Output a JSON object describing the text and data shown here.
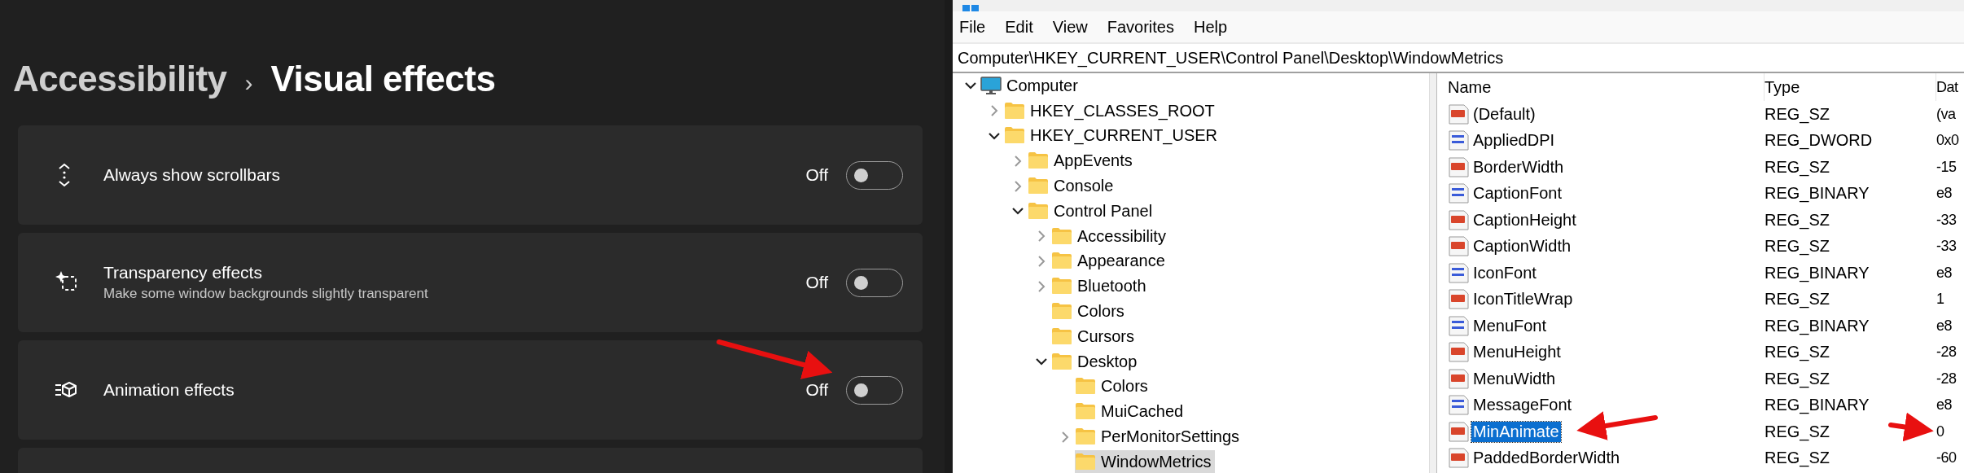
{
  "settings": {
    "breadcrumb": {
      "parent": "Accessibility",
      "separator": "›",
      "current": "Visual effects"
    },
    "cards": [
      {
        "kind": "scrollbars",
        "title": "Always show scrollbars",
        "state_label": "Off",
        "on": false
      },
      {
        "kind": "transparency",
        "title": "Transparency effects",
        "subtitle": "Make some window backgrounds slightly transparent",
        "state_label": "Off",
        "on": false
      },
      {
        "kind": "animation",
        "title": "Animation effects",
        "state_label": "Off",
        "on": false
      }
    ]
  },
  "registry": {
    "menu": [
      "File",
      "Edit",
      "View",
      "Favorites",
      "Help"
    ],
    "address": "Computer\\HKEY_CURRENT_USER\\Control Panel\\Desktop\\WindowMetrics",
    "tree": [
      {
        "label": "Computer",
        "kind": "computer",
        "expanded": true,
        "selected": false,
        "children": [
          {
            "label": "HKEY_CLASSES_ROOT",
            "kind": "branch",
            "expanded": false,
            "selected": false
          },
          {
            "label": "HKEY_CURRENT_USER",
            "kind": "branch",
            "expanded": true,
            "selected": false,
            "children": [
              {
                "label": "AppEvents",
                "kind": "branch",
                "expanded": false,
                "selected": false
              },
              {
                "label": "Console",
                "kind": "branch",
                "expanded": false,
                "selected": false
              },
              {
                "label": "Control Panel",
                "kind": "branch",
                "expanded": true,
                "selected": false,
                "children": [
                  {
                    "label": "Accessibility",
                    "kind": "branch",
                    "expanded": false,
                    "selected": false
                  },
                  {
                    "label": "Appearance",
                    "kind": "branch",
                    "expanded": false,
                    "selected": false
                  },
                  {
                    "label": "Bluetooth",
                    "kind": "branch",
                    "expanded": false,
                    "selected": false
                  },
                  {
                    "label": "Colors",
                    "kind": "leaf",
                    "selected": false
                  },
                  {
                    "label": "Cursors",
                    "kind": "leaf",
                    "selected": false
                  },
                  {
                    "label": "Desktop",
                    "kind": "branch",
                    "expanded": true,
                    "selected": false,
                    "children": [
                      {
                        "label": "Colors",
                        "kind": "leaf",
                        "selected": false
                      },
                      {
                        "label": "MuiCached",
                        "kind": "leaf",
                        "selected": false
                      },
                      {
                        "label": "PerMonitorSettings",
                        "kind": "branch",
                        "expanded": false,
                        "selected": false
                      },
                      {
                        "label": "WindowMetrics",
                        "kind": "leaf",
                        "selected": true
                      }
                    ]
                  }
                ]
              }
            ]
          }
        ]
      }
    ],
    "columns": [
      "Name",
      "Type",
      "Dat"
    ],
    "rows": [
      {
        "kind": "string",
        "name": "(Default)",
        "type": "REG_SZ",
        "data": "(va",
        "selected": false
      },
      {
        "kind": "binary",
        "name": "AppliedDPI",
        "type": "REG_DWORD",
        "data": "0x0",
        "selected": false
      },
      {
        "kind": "string",
        "name": "BorderWidth",
        "type": "REG_SZ",
        "data": "-15",
        "selected": false
      },
      {
        "kind": "binary",
        "name": "CaptionFont",
        "type": "REG_BINARY",
        "data": "e8",
        "selected": false
      },
      {
        "kind": "string",
        "name": "CaptionHeight",
        "type": "REG_SZ",
        "data": "-33",
        "selected": false
      },
      {
        "kind": "string",
        "name": "CaptionWidth",
        "type": "REG_SZ",
        "data": "-33",
        "selected": false
      },
      {
        "kind": "binary",
        "name": "IconFont",
        "type": "REG_BINARY",
        "data": "e8",
        "selected": false
      },
      {
        "kind": "string",
        "name": "IconTitleWrap",
        "type": "REG_SZ",
        "data": "1",
        "selected": false
      },
      {
        "kind": "binary",
        "name": "MenuFont",
        "type": "REG_BINARY",
        "data": "e8",
        "selected": false
      },
      {
        "kind": "string",
        "name": "MenuHeight",
        "type": "REG_SZ",
        "data": "-28",
        "selected": false
      },
      {
        "kind": "string",
        "name": "MenuWidth",
        "type": "REG_SZ",
        "data": "-28",
        "selected": false
      },
      {
        "kind": "binary",
        "name": "MessageFont",
        "type": "REG_BINARY",
        "data": "e8",
        "selected": false
      },
      {
        "kind": "string",
        "name": "MinAnimate",
        "type": "REG_SZ",
        "data": "0",
        "selected": true
      },
      {
        "kind": "string",
        "name": "PaddedBorderWidth",
        "type": "REG_SZ",
        "data": "-60",
        "selected": false
      }
    ]
  }
}
